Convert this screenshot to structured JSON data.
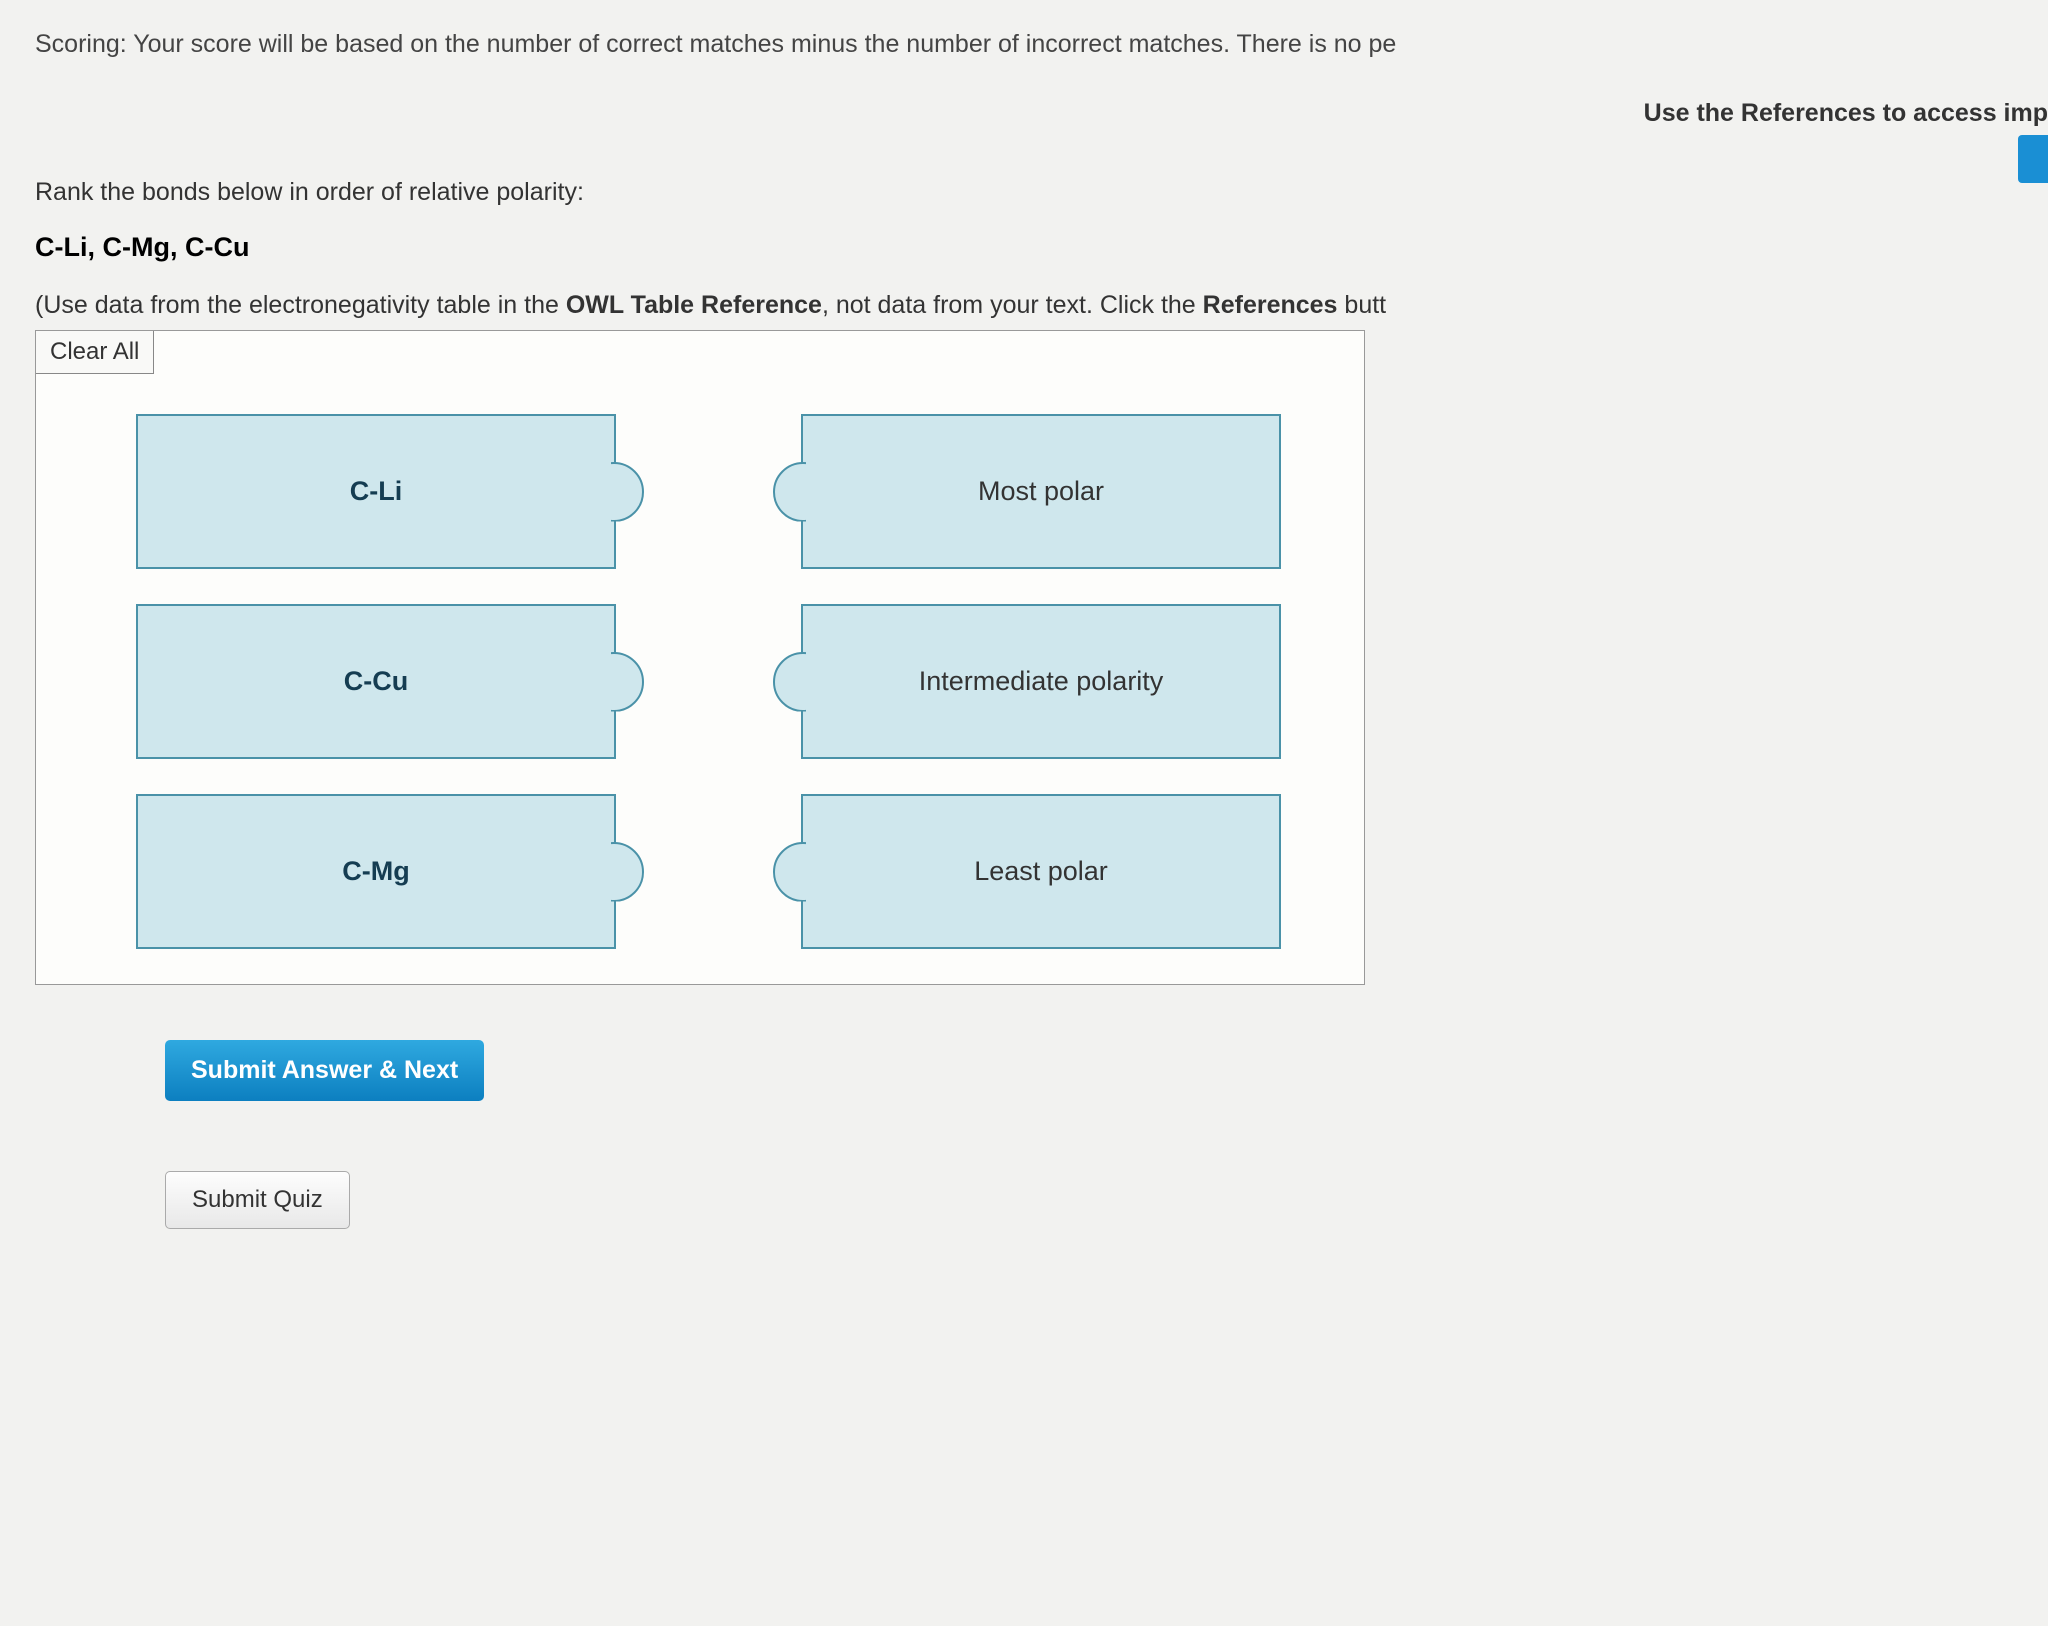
{
  "scoring_text": "Scoring: Your score will be based on the number of correct matches minus the number of incorrect matches. There is no pe",
  "references_hint": "Use the References to access imp",
  "question_text": "Rank the bonds below in order of relative polarity:",
  "bond_list": "C-Li, C-Mg, C-Cu",
  "instruction_prefix": "(Use data from the electronegativity table in the ",
  "instruction_bold1": "OWL Table Reference",
  "instruction_mid": ", not data from your text. Click the ",
  "instruction_bold2": "References",
  "instruction_suffix": " butt",
  "clear_all": "Clear All",
  "left_items": [
    "C-Li",
    "C-Cu",
    "C-Mg"
  ],
  "right_items": [
    "Most polar",
    "Intermediate polarity",
    "Least polar"
  ],
  "submit_answer": "Submit Answer & Next",
  "submit_quiz": "Submit Quiz"
}
